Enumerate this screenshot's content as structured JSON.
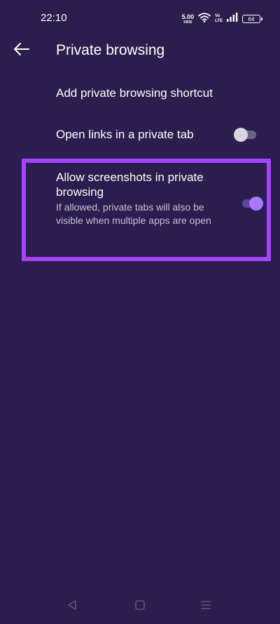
{
  "status_bar": {
    "time": "22:10",
    "net_speed_value": "5.00",
    "net_speed_unit": "KB/S",
    "volte_top": "Vo",
    "volte_bottom": "LTE",
    "battery_level": "64",
    "icons": [
      "wifi-icon",
      "signal-icon",
      "battery-icon"
    ]
  },
  "app_bar": {
    "title": "Private browsing",
    "back_icon": "arrow-left-icon"
  },
  "settings": {
    "add_shortcut": {
      "title": "Add private browsing shortcut"
    },
    "open_links": {
      "title": "Open links in a private tab",
      "enabled": false
    },
    "allow_screenshots": {
      "title": "Allow screenshots in private browsing",
      "summary": "If allowed, private tabs will also be visible when multiple apps are open",
      "enabled": true
    }
  },
  "nav_bar": {
    "icons": [
      "back-triangle-icon",
      "home-square-icon",
      "menu-lines-icon"
    ]
  },
  "colors": {
    "background": "#2b1d4e",
    "accent_thumb": "#a877ff",
    "accent_track": "#5e43a0",
    "highlight": "#a543ff",
    "summary_text": "#c6bfd8"
  }
}
